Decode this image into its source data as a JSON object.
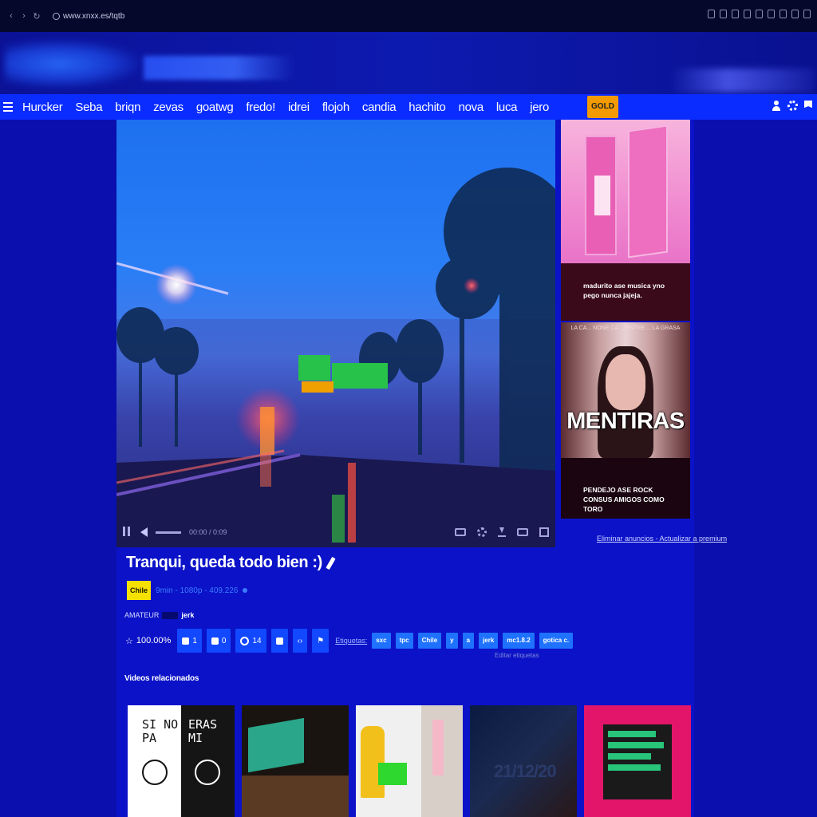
{
  "browser": {
    "url": "www.xnxx.es/tqtb"
  },
  "nav": {
    "items": [
      "Hurcker",
      "Seba",
      "briqn",
      "zevas",
      "goatwg",
      "fredo!",
      "idrei",
      "flojoh",
      "candia",
      "hachito",
      "nova",
      "luca",
      "jero"
    ],
    "gold_label": "GOLD"
  },
  "video": {
    "title": "Tranqui, queda todo bien :)",
    "time": "00:00 / 0:09",
    "country_badge": "Chile",
    "meta": "9min - 1080p - 409.226",
    "uploader_prefix": "AMATEUR",
    "uploader_suffix": "jerk",
    "rating": "100.00%",
    "likes": "1",
    "dislikes": "0",
    "comments": "14",
    "tags_label": "Etiquetas:",
    "tags": [
      "sxc",
      "tpc",
      "Chile",
      "y",
      "a",
      "jerk",
      "mc1.8.2",
      "gotica c."
    ],
    "edit_tags": "Editar etiquetas"
  },
  "ads": {
    "ad1_caption": "madurito ase musica yno pego nunca jajeja.",
    "ad2_top_text": "LA CA... NONE CA ... ENTRE ... LA GRASA",
    "ad2_big_text": "MENTIRAS",
    "ad2_caption": "PENDEJO ASE ROCK CONSUS AMIGOS COMO TORO",
    "remove_ads": "Eliminar anuncios - Actualizar a premium"
  },
  "related": {
    "title": "Videos relacionados",
    "thumb1_left": "SI NO\nPA",
    "thumb1_right": "ERAS\nMI",
    "thumb4_date": "21/12/20"
  },
  "icons": [
    "menu-icon",
    "user-icon",
    "gear-icon",
    "flag-icon",
    "pencil-icon",
    "star-icon",
    "thumbs-up-icon",
    "thumbs-down-icon",
    "comment-icon",
    "download-icon",
    "embed-icon",
    "report-icon"
  ]
}
